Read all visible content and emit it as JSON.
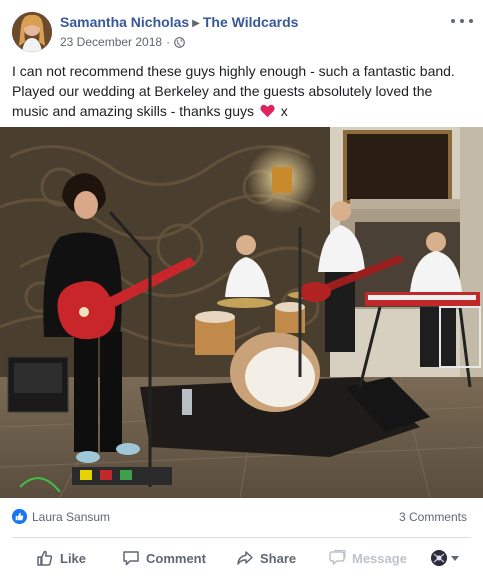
{
  "post": {
    "author": "Samantha Nicholas",
    "target_page": "The Wildcards",
    "date": "23 December 2018",
    "separator": "·",
    "privacy_icon": "globe-icon",
    "more_icon": "more-options-icon",
    "text_before_heart": "I can not recommend these guys highly enough - such a fantastic band. Played our wedding at Berkeley and the guests absolutely loved the music and amazing skills - thanks guys",
    "heart_icon": "red-heart-emoji",
    "text_after_heart": "x",
    "heart_color": "#e0245e"
  },
  "reactions": {
    "reactor_name": "Laura Sansum",
    "comments_count": "3 Comments",
    "like_color": "#1877f2"
  },
  "actions": {
    "like": "Like",
    "comment": "Comment",
    "share": "Share",
    "message": "Message"
  },
  "colors": {
    "link": "#385898",
    "secondary_text": "#606770",
    "disabled_text": "#bec3c9"
  }
}
